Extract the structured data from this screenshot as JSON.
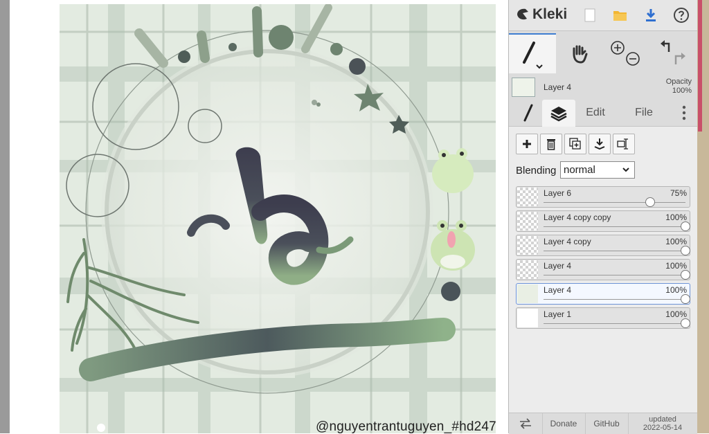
{
  "canvas": {
    "watermark": "@nguyentrantuguyen_#hd247"
  },
  "app": {
    "name": "Kleki",
    "colors": {
      "accent": "#3f7ed1",
      "download": "#2f6fd0",
      "folder": "#f2b632"
    }
  },
  "topbar": {
    "icons": [
      "kleki-logo-icon",
      "new-document-icon",
      "open-folder-icon",
      "download-icon",
      "help-icon"
    ]
  },
  "tools": {
    "items": [
      "brush-tool-icon",
      "hand-tool-icon",
      "zoom-in-icon",
      "zoom-out-icon",
      "undo-icon",
      "redo-icon"
    ]
  },
  "current_layer": {
    "name": "Layer 4",
    "opacity_label": "Opacity",
    "opacity_value": "100%"
  },
  "tabs": {
    "edit": "Edit",
    "file": "File"
  },
  "layers_panel": {
    "blending_label": "Blending",
    "blending_value": "normal",
    "buttons": [
      "add-layer-icon",
      "delete-layer-icon",
      "duplicate-layer-icon",
      "merge-down-icon",
      "rename-layer-icon"
    ],
    "layers": [
      {
        "name": "Layer 6",
        "opacity": "75%",
        "opacity_value": 0.75,
        "thumb": "checker",
        "selected": false
      },
      {
        "name": "Layer 4 copy copy",
        "opacity": "100%",
        "opacity_value": 1.0,
        "thumb": "checker",
        "selected": false
      },
      {
        "name": "Layer 4 copy",
        "opacity": "100%",
        "opacity_value": 1.0,
        "thumb": "checker",
        "selected": false
      },
      {
        "name": "Layer 4",
        "opacity": "100%",
        "opacity_value": 1.0,
        "thumb": "checker",
        "selected": false
      },
      {
        "name": "Layer 4",
        "opacity": "100%",
        "opacity_value": 1.0,
        "thumb": "art",
        "selected": true
      },
      {
        "name": "Layer 1",
        "opacity": "100%",
        "opacity_value": 1.0,
        "thumb": "white",
        "selected": false
      }
    ]
  },
  "footer": {
    "donate": "Donate",
    "github": "GitHub",
    "updated_label": "updated",
    "updated_date": "2022-05-14"
  }
}
